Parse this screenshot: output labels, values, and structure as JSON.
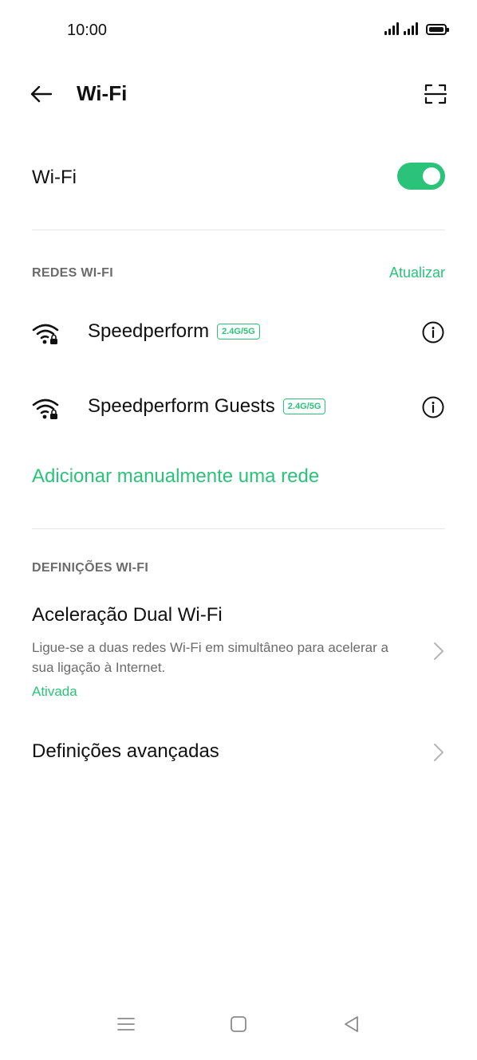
{
  "status_bar": {
    "time": "10:00"
  },
  "header": {
    "title": "Wi-Fi",
    "back_icon": "arrow-left-icon",
    "scan_icon": "qr-scan-icon"
  },
  "wifi_toggle": {
    "label": "Wi-Fi",
    "enabled": true
  },
  "networks_section": {
    "header": "REDES WI-FI",
    "refresh_label": "Atualizar",
    "networks": [
      {
        "name": "Speedperform",
        "band": "2.4G/5G",
        "icon": "wifi-locked-icon"
      },
      {
        "name": "Speedperform Guests",
        "band": "2.4G/5G",
        "icon": "wifi-locked-icon"
      }
    ],
    "add_network_label": "Adicionar manualmente uma rede"
  },
  "settings_section": {
    "header": "DEFINIÇÕES WI-FI",
    "items": [
      {
        "title": "Aceleração Dual Wi-Fi",
        "description": "Ligue-se a duas redes Wi-Fi em simultâneo para acelerar a sua ligação à Internet.",
        "status": "Ativada"
      },
      {
        "title": "Definições avançadas"
      }
    ]
  },
  "colors": {
    "accent": "#2bc37a",
    "text_primary": "#111111",
    "text_secondary": "#6b6b6b",
    "divider": "#e4e4e4"
  },
  "nav_bar": {
    "menu_icon": "menu-icon",
    "home_icon": "home-icon",
    "back_icon": "back-triangle-icon"
  }
}
